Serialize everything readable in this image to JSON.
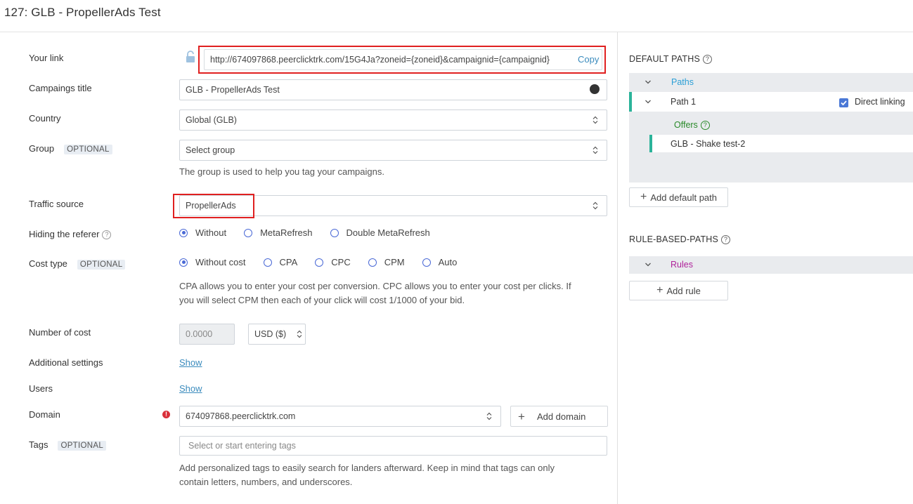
{
  "page": {
    "title": "127: GLB - PropellerAds Test"
  },
  "form": {
    "your_link": {
      "label": "Your link",
      "value": "http://674097868.peerclicktrk.com/15G4Ja?zoneid={zoneid}&campaignid={campaignid}",
      "copy_label": "Copy"
    },
    "campaign_title": {
      "label": "Campaings title",
      "value": "GLB - PropellerAds Test"
    },
    "country": {
      "label": "Country",
      "value": "Global (GLB)"
    },
    "group": {
      "label": "Group",
      "optional": "OPTIONAL",
      "placeholder": "Select group",
      "hint": "The group is used to help you tag your campaigns."
    },
    "traffic_source": {
      "label": "Traffic source",
      "value": "PropellerAds"
    },
    "hiding_referer": {
      "label": "Hiding the referer",
      "help": "?",
      "options": [
        "Without",
        "MetaRefresh",
        "Double MetaRefresh"
      ],
      "selected": "Without"
    },
    "cost_type": {
      "label": "Cost type",
      "optional": "OPTIONAL",
      "options": [
        "Without cost",
        "CPA",
        "CPC",
        "CPM",
        "Auto"
      ],
      "selected": "Without cost",
      "hint_line1": "CPA allows you to enter your cost per conversion. CPC allows you to enter your cost per clicks. If",
      "hint_line2": "you will select CPM then each of your click will cost 1/1000 of your bid."
    },
    "number_of_cost": {
      "label": "Number of cost",
      "value": "0.0000",
      "currency": "USD ($)"
    },
    "additional_settings": {
      "label": "Additional settings",
      "link": "Show"
    },
    "users": {
      "label": "Users",
      "link": "Show"
    },
    "domain": {
      "label": "Domain",
      "value": "674097868.peerclicktrk.com",
      "add_label": "Add domain",
      "warning": "!"
    },
    "tags": {
      "label": "Tags",
      "optional": "OPTIONAL",
      "placeholder": "Select or start entering tags",
      "hint_line1": "Add personalized tags to easily search for landers afterward. Keep in mind that tags can only",
      "hint_line2": "contain letters, numbers, and underscores."
    }
  },
  "right": {
    "default_paths": {
      "heading": "DEFAULT PATHS",
      "help": "?",
      "paths_label": "Paths",
      "path1": "Path 1",
      "direct_linking": "Direct linking",
      "direct_linking_checked": true,
      "offers_label": "Offers",
      "offers_help": "?",
      "offer": "GLB - Shake test-2",
      "add_button": "Add default path"
    },
    "rule_based": {
      "heading": "RULE-BASED-PATHS",
      "help": "?",
      "rules_label": "Rules",
      "add_button": "Add rule"
    }
  },
  "colors": {
    "accent_blue": "#4a69d6",
    "highlight_red": "#e02020",
    "teal_bar": "#2bb39a",
    "paths_blue": "#2b9fd6",
    "offers_green": "#2a8a2a",
    "rules_purple": "#b0239b"
  }
}
